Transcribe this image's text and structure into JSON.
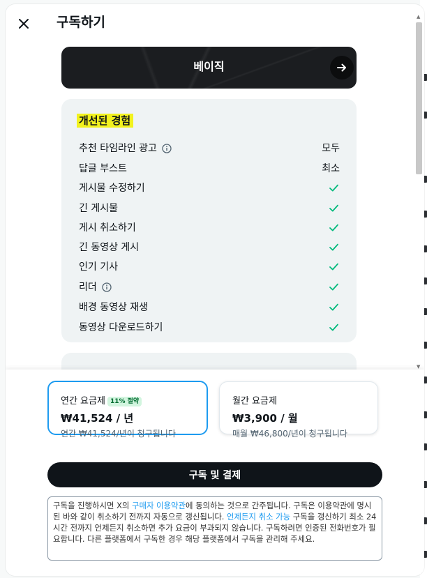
{
  "header": {
    "title": "구독하기",
    "close_icon": "close-icon"
  },
  "plan": {
    "label": "베이직",
    "arrow_icon": "arrow-right-icon"
  },
  "features": {
    "heading": "개선된 경험",
    "rows": [
      {
        "label": "추천 타임라인 광고",
        "info": true,
        "value": "모두"
      },
      {
        "label": "답글 부스트",
        "info": false,
        "value": "최소"
      },
      {
        "label": "게시물 수정하기",
        "info": false,
        "check": true
      },
      {
        "label": "긴 게시물",
        "info": false,
        "check": true
      },
      {
        "label": "게시 취소하기",
        "info": false,
        "check": true
      },
      {
        "label": "긴 동영상 게시",
        "info": false,
        "check": true
      },
      {
        "label": "인기 기사",
        "info": false,
        "check": true
      },
      {
        "label": "리더",
        "info": true,
        "check": true
      },
      {
        "label": "배경 동영상 재생",
        "info": false,
        "check": true
      },
      {
        "label": "동영상 다운로드하기",
        "info": false,
        "check": true
      }
    ],
    "check_color": "#00ba7c"
  },
  "pricing": {
    "annual": {
      "title": "연간 요금제",
      "badge": "11% 절약",
      "price": "₩41,524 / 년",
      "note": "연간 ₩41,524/년이 청구됩니다",
      "selected": true
    },
    "monthly": {
      "title": "월간 요금제",
      "price": "₩3,900 / 월",
      "note": "매월 ₩46,800/년이 청구됩니다",
      "selected": false
    }
  },
  "subscribe_button": "구독 및 결제",
  "terms": {
    "text1": "구독을 진행하시면 X의 ",
    "link1": "구매자 이용약관",
    "text2": "에 동의하는 것으로 간주됩니다. 구독은 이용약관에 명시된 바와 같이 취소하기 전까지 자동으로 갱신됩니다. ",
    "link2": "언제든지 취소 가능",
    "text3": " 구독을 갱신하기 최소 24시간 전까지 언제든지 취소하면 추가 요금이 부과되지 않습니다. 구독하려면 인증된 전화번호가 필요합니다. 다른 플랫폼에서 구독한 경우 해당 플랫폼에서 구독을 관리해 주세요."
  },
  "colors": {
    "accent": "#1d9bf0",
    "highlight": "#f2f21e",
    "dark": "#0f1419"
  }
}
